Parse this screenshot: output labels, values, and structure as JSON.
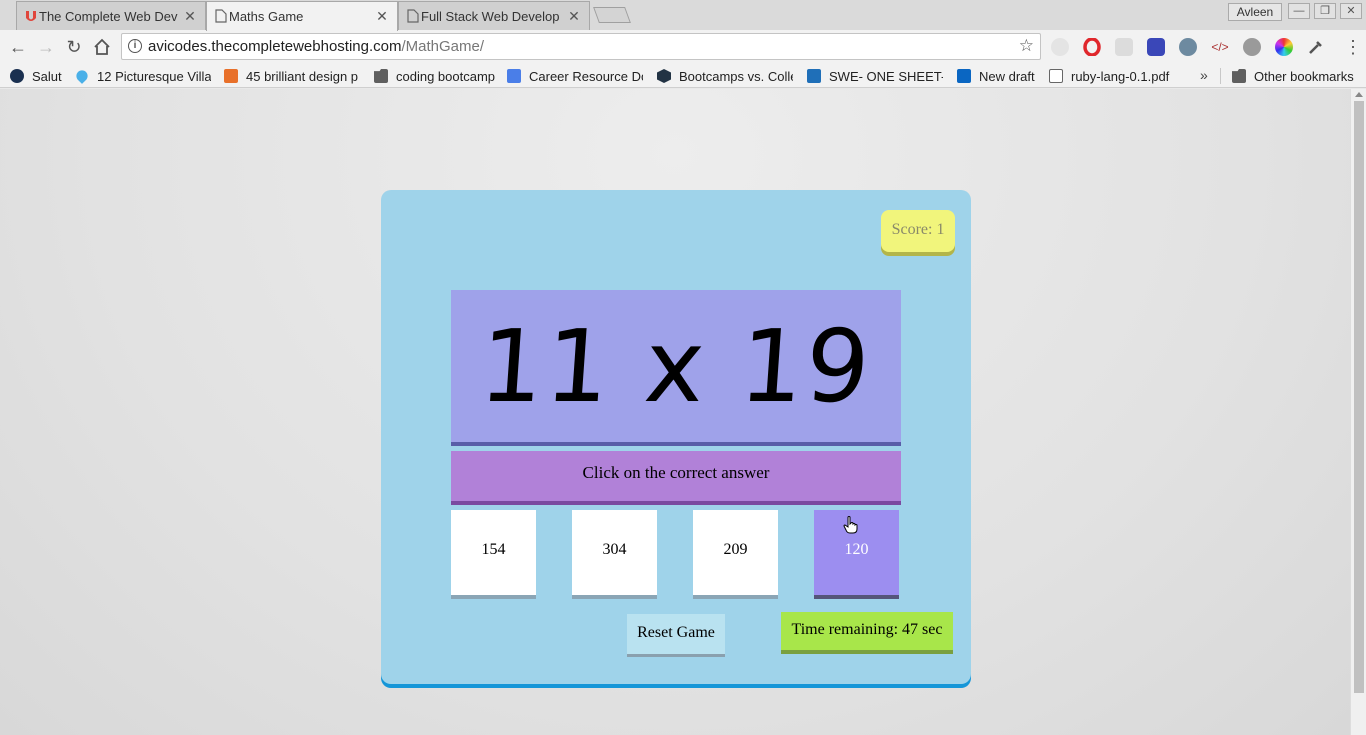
{
  "browser": {
    "tabs": [
      {
        "title": "The Complete Web Dev",
        "active": false
      },
      {
        "title": "Maths Game",
        "active": true
      },
      {
        "title": "Full Stack Web Develop",
        "active": false
      }
    ],
    "profile_name": "Avleen",
    "url_host": "avicodes.thecompletewebhosting.com",
    "url_path": "/MathGame/",
    "bookmarks": [
      "Salut",
      "12 Picturesque Villag",
      "45 brilliant design p",
      "coding bootcamp",
      "Career Resource Do",
      "Bootcamps vs. Colle",
      "SWE- ONE SHEET-w",
      "New draft",
      "ruby-lang-0.1.pdf"
    ],
    "other_bookmarks": "Other bookmarks"
  },
  "game": {
    "score_label": "Score: 1",
    "question": "11 x 19",
    "instruction": "Click on the correct answer",
    "choices": [
      "154",
      "304",
      "209",
      "120"
    ],
    "hovered_choice": 4,
    "reset_label": "Reset Game",
    "timer_label": "Time remaining: 47 sec",
    "colors": {
      "container": "#9fd3ea",
      "score": "#f1f57c",
      "question": "#9fa2ea",
      "instruction": "#b181d8",
      "choice_hover": "#9c8ef0",
      "timer": "#a8e64a",
      "reset": "#b9e2f0"
    }
  }
}
